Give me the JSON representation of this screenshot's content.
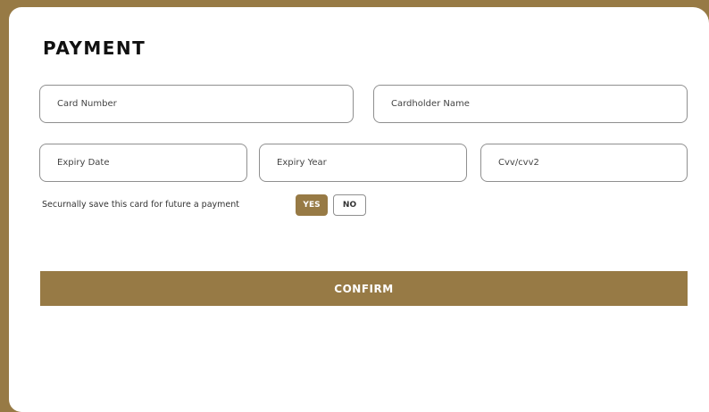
{
  "page": {
    "title": "PAYMENT"
  },
  "form": {
    "card_number": {
      "value": "",
      "placeholder": "Card Number"
    },
    "cardholder_name": {
      "value": "",
      "placeholder": "Cardholder Name"
    },
    "expiry_date": {
      "value": "",
      "placeholder": "Expiry Date"
    },
    "expiry_year": {
      "value": "",
      "placeholder": "Expiry Year"
    },
    "cvv": {
      "value": "",
      "placeholder": "Cvv/cvv2"
    }
  },
  "save_card": {
    "label": "Securnally save this card for future a payment",
    "yes_label": "YES",
    "no_label": "NO",
    "selected": "YES"
  },
  "actions": {
    "confirm_label": "CONFIRM"
  },
  "colors": {
    "accent": "#977a45",
    "card_background": "#ffffff",
    "border": "#8f8f8f"
  }
}
